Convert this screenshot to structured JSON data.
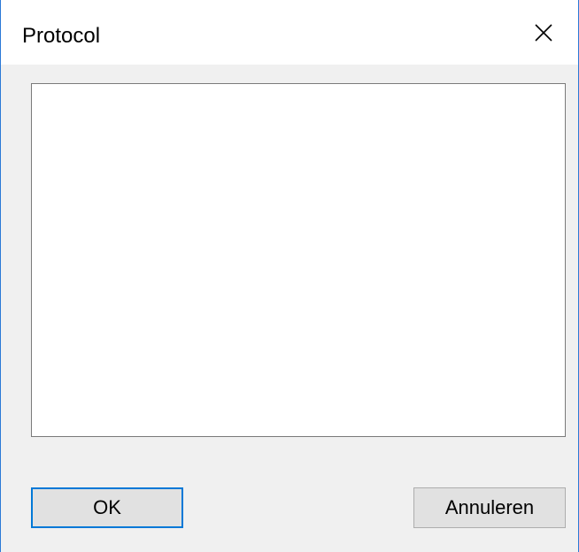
{
  "dialog": {
    "title": "Protocol",
    "close_icon": "close-icon",
    "text_value": "",
    "ok_label": "OK",
    "cancel_label": "Annuleren"
  },
  "colors": {
    "window_border": "#2b79d7",
    "dialog_background": "#f0f0f0",
    "titlebar_background": "#ffffff",
    "default_button_border": "#0078d7",
    "button_background": "#e1e1e1"
  }
}
